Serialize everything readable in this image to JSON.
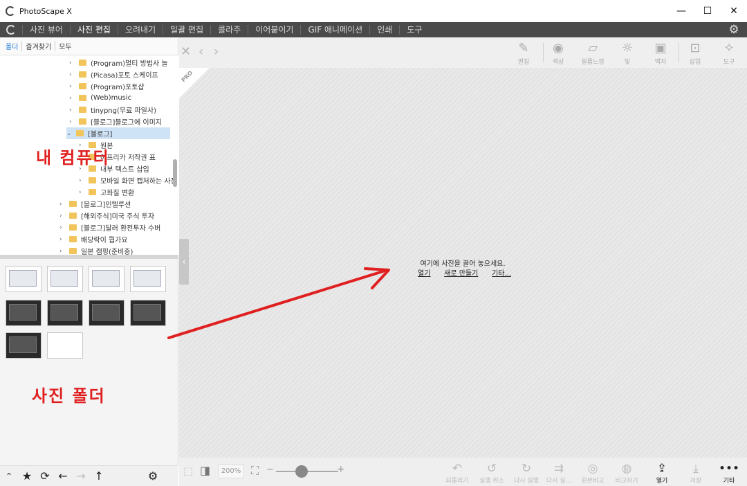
{
  "window": {
    "title": "PhotoScape X",
    "controls": [
      "—",
      "☐",
      "✕"
    ]
  },
  "menu": {
    "items": [
      "사진 뷰어",
      "사진 편집",
      "오려내기",
      "일괄 편집",
      "콜라주",
      "이어붙이기",
      "GIF 애니메이션",
      "인쇄",
      "도구"
    ],
    "active": "사진 편집"
  },
  "left_panel": {
    "tabs": [
      "폴더",
      "즐겨찾기",
      "모두"
    ],
    "tree": [
      "(Program)멀티 방법사 늘",
      "(Picasa)포토 스케이프",
      "(Program)포토샵",
      "(Web)music",
      "tinypng(무료 파일사)",
      "[블로그]블로그에 이미지",
      "[블로그]",
      "원본",
      "아프리카 저작권 표",
      "내부 텍스트 삽입",
      "모바일 화면 캡처하는 사진",
      "고화질 변환",
      "[블로그]인텔루션",
      "[해외주식]미국 주식 투자",
      "[블로그]달러 환전투자 수버",
      "배당락이 뭡가요",
      "일본 캠핑(준비중)"
    ]
  },
  "annotations": {
    "computer": "내 컴퓨터",
    "folder": "사진 폴더"
  },
  "toolbar": {
    "tools": [
      "편집",
      "색상",
      "필름느낌",
      "빛",
      "액자",
      "삽입",
      "도구"
    ]
  },
  "stage": {
    "badge": "PRO",
    "drop_message": "여기에 사진을 끌어 놓으세요.",
    "links": [
      "열기",
      "새로 만들기",
      "기타..."
    ]
  },
  "bottom": {
    "zoom": "200%",
    "actions": [
      "되돌리기",
      "실행 취소",
      "다시 실행",
      "다시 실...",
      "원본비교",
      "비교하기",
      "열기",
      "저장",
      "기타"
    ]
  },
  "colors": {
    "menubar": "#4a4a4a",
    "accent_tab": "#2a7fd4",
    "annotation_red": "#e02020",
    "folder_yellow": "#f2c55c"
  }
}
